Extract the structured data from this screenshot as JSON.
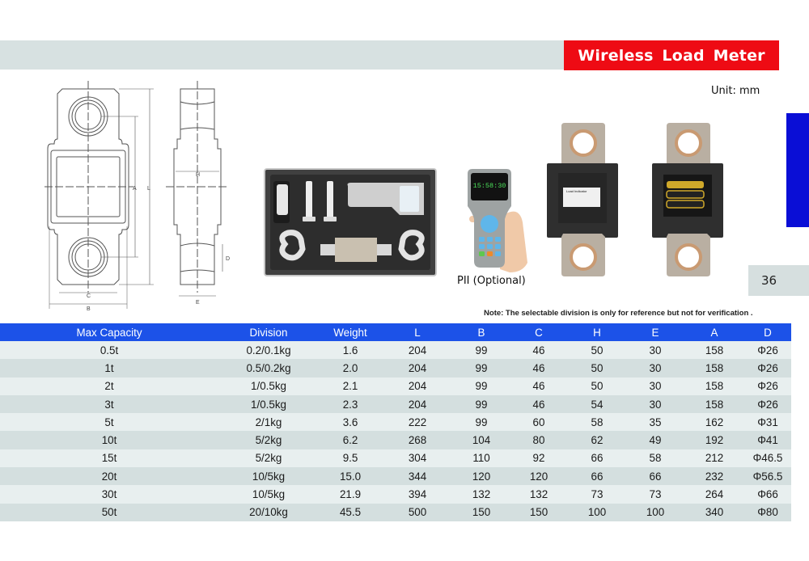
{
  "header": {
    "title": "Wireless Load Meter",
    "unit_label": "Unit: mm",
    "page_number": "36"
  },
  "colors": {
    "title_bg": "#ee0b14",
    "table_header_bg": "#1c52e8",
    "side_tab": "#0a0ed6",
    "band": "#d7e1e1"
  },
  "drawing": {
    "dimension_labels": [
      "L",
      "A",
      "B",
      "C",
      "H",
      "E",
      "D"
    ]
  },
  "photos": {
    "kit_case": "carrying-case-with-handheld-remote-shackles-and-load-cell",
    "handheld_caption": "PII (Optional)",
    "handheld_display": "15:58:30",
    "meter_front_label": "Load Indicator",
    "meter_back": "battery-compartment"
  },
  "note": "Note: The selectable division is only for reference but not for verification .",
  "table": {
    "columns": [
      "Max Capacity",
      "Division",
      "Weight",
      "L",
      "B",
      "C",
      "H",
      "E",
      "A",
      "D"
    ],
    "rows": [
      [
        "0.5t",
        "0.2/0.1kg",
        "1.6",
        "204",
        "99",
        "46",
        "50",
        "30",
        "158",
        "Φ26"
      ],
      [
        "1t",
        "0.5/0.2kg",
        "2.0",
        "204",
        "99",
        "46",
        "50",
        "30",
        "158",
        "Φ26"
      ],
      [
        "2t",
        "1/0.5kg",
        "2.1",
        "204",
        "99",
        "46",
        "50",
        "30",
        "158",
        "Φ26"
      ],
      [
        "3t",
        "1/0.5kg",
        "2.3",
        "204",
        "99",
        "46",
        "54",
        "30",
        "158",
        "Φ26"
      ],
      [
        "5t",
        "2/1kg",
        "3.6",
        "222",
        "99",
        "60",
        "58",
        "35",
        "162",
        "Φ31"
      ],
      [
        "10t",
        "5/2kg",
        "6.2",
        "268",
        "104",
        "80",
        "62",
        "49",
        "192",
        "Φ41"
      ],
      [
        "15t",
        "5/2kg",
        "9.5",
        "304",
        "110",
        "92",
        "66",
        "58",
        "212",
        "Φ46.5"
      ],
      [
        "20t",
        "10/5kg",
        "15.0",
        "344",
        "120",
        "120",
        "66",
        "66",
        "232",
        "Φ56.5"
      ],
      [
        "30t",
        "10/5kg",
        "21.9",
        "394",
        "132",
        "132",
        "73",
        "73",
        "264",
        "Φ66"
      ],
      [
        "50t",
        "20/10kg",
        "45.5",
        "500",
        "150",
        "150",
        "100",
        "100",
        "340",
        "Φ80"
      ]
    ]
  }
}
